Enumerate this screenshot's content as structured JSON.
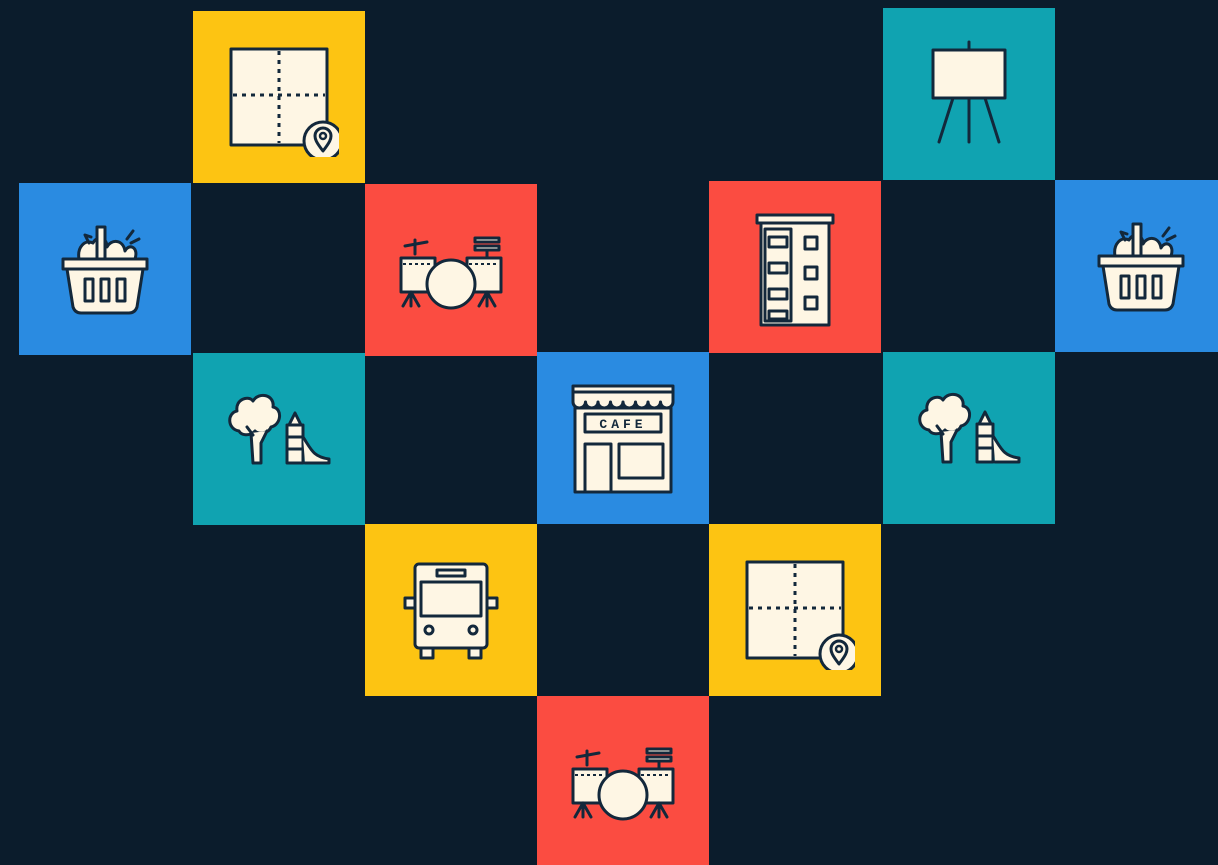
{
  "colors": {
    "background": "#0b1c2c",
    "yellow": "#fdc412",
    "teal": "#10a3b1",
    "blue": "#2a8be1",
    "red": "#fb4c41",
    "outline": "#13283b",
    "fill": "#fef6e4"
  },
  "tiles": [
    {
      "icon": "map-location-icon",
      "color": "yellow"
    },
    {
      "icon": "easel-icon",
      "color": "teal"
    },
    {
      "icon": "grocery-basket-icon",
      "color": "blue"
    },
    {
      "icon": "drum-kit-icon",
      "color": "red"
    },
    {
      "icon": "apartment-building-icon",
      "color": "red"
    },
    {
      "icon": "grocery-basket-icon",
      "color": "blue"
    },
    {
      "icon": "park-playground-icon",
      "color": "teal"
    },
    {
      "icon": "cafe-storefront-icon",
      "color": "blue"
    },
    {
      "icon": "park-playground-icon",
      "color": "teal"
    },
    {
      "icon": "bus-icon",
      "color": "yellow"
    },
    {
      "icon": "map-location-icon",
      "color": "yellow"
    },
    {
      "icon": "drum-kit-icon",
      "color": "red"
    }
  ],
  "cafe": {
    "sign": "CAFE"
  }
}
